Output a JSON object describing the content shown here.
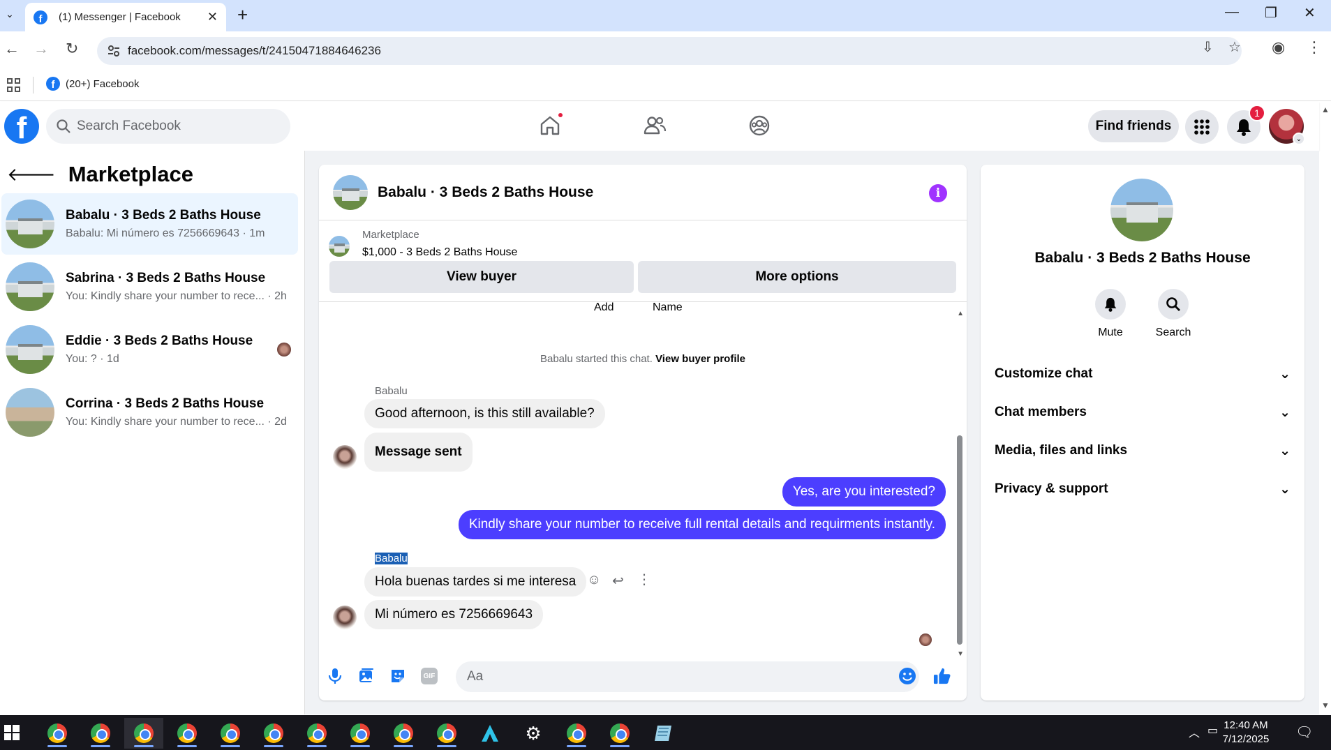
{
  "browser": {
    "tab_title": "(1) Messenger | Facebook",
    "url": "facebook.com/messages/t/24150471884646236",
    "bookmark": "(20+) Facebook"
  },
  "fb": {
    "logo": "f",
    "search_placeholder": "Search Facebook",
    "find_friends": "Find friends",
    "notification_count": "1"
  },
  "left": {
    "title": "Marketplace",
    "conversations": [
      {
        "name": "Babalu · 3 Beds 2 Baths House",
        "preview": "Babalu: Mi número es 7256669643 · 1m"
      },
      {
        "name": "Sabrina · 3 Beds 2 Baths House",
        "preview": "You: Kindly share your number to rece... · 2h"
      },
      {
        "name": "Eddie · 3 Beds 2 Baths House",
        "preview": "You: ? · 1d"
      },
      {
        "name": "Corrina · 3 Beds 2 Baths House",
        "preview": "You: Kindly share your number to rece... · 2d"
      }
    ]
  },
  "chat": {
    "title": "Babalu · 3 Beds 2 Baths House",
    "marketplace_label": "Marketplace",
    "listing": "$1,000 - 3 Beds 2 Baths House",
    "view_buyer": "View buyer",
    "more_options": "More options",
    "cut_add": "Add",
    "cut_name": "Name",
    "started": "Babalu started this chat.",
    "view_profile": "View buyer profile",
    "messages": [
      {
        "sender": "Babalu",
        "text": "Good afternoon, is this still available?"
      },
      {
        "text": "Message sent"
      },
      {
        "text": "Yes, are you interested?"
      },
      {
        "text": "Kindly share your number to receive full rental details and requirments instantly."
      },
      {
        "sender": "Babalu",
        "text": "Hola buenas tardes si me interesa"
      },
      {
        "text": "Mi número es 7256669643"
      }
    ],
    "composer_placeholder": "Aa",
    "gif": "GIF"
  },
  "right": {
    "name": "Babalu · 3 Beds 2 Baths House",
    "mute": "Mute",
    "search": "Search",
    "sections": [
      "Customize chat",
      "Chat members",
      "Media, files and links",
      "Privacy & support"
    ]
  },
  "taskbar": {
    "time": "12:40 AM",
    "date": "7/12/2025"
  },
  "colors": {
    "fb_blue": "#1877f2",
    "outgoing_bubble": "#4c3eff",
    "info_purple": "#a033ff",
    "notification_red": "#e41e3f"
  }
}
